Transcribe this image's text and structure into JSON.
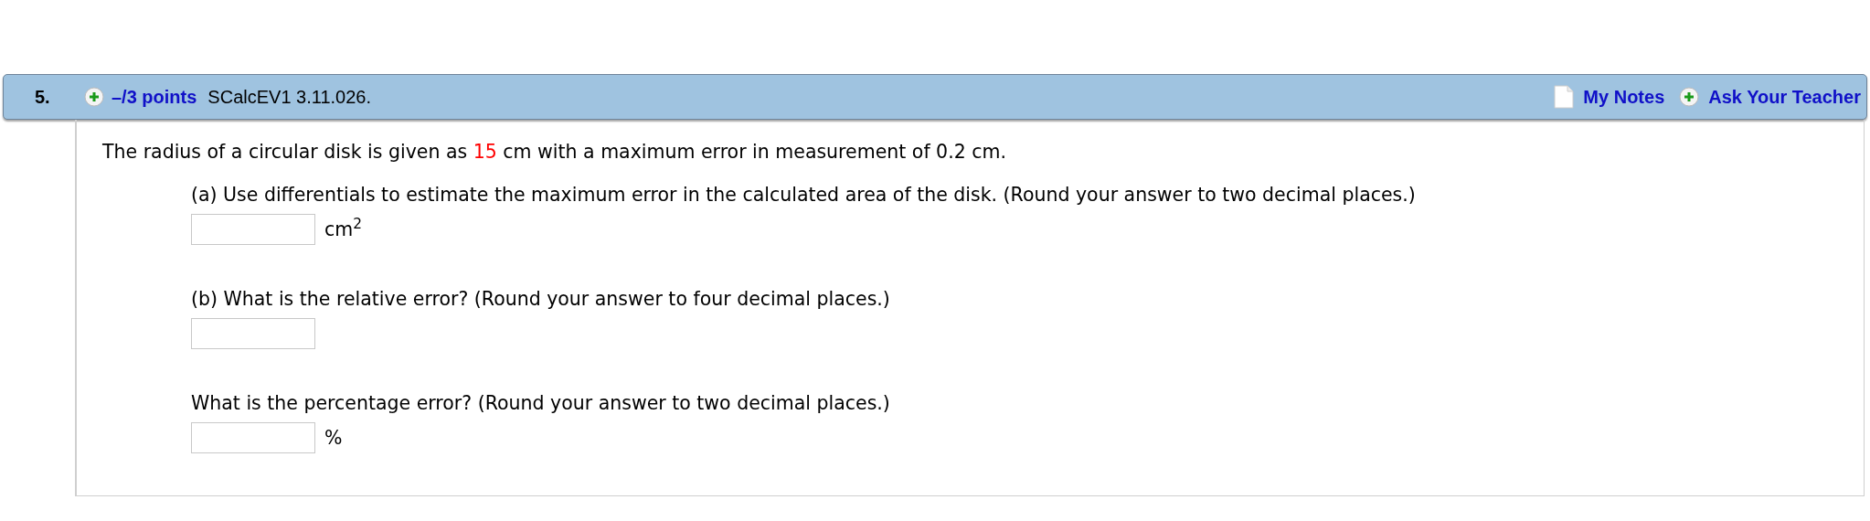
{
  "question": {
    "number": "5.",
    "points": "–/3 points",
    "source": "SCalcEV1 3.11.026.",
    "links": [
      {
        "kind": "notes",
        "label": "My Notes"
      },
      {
        "kind": "ask",
        "label": "Ask Your Teacher"
      }
    ]
  },
  "intro": {
    "before": "The radius of a circular disk is given as ",
    "value": "15",
    "after": " cm with a maximum error in measurement of 0.2 cm."
  },
  "parts": [
    {
      "prompt": "(a) Use differentials to estimate the maximum error in the calculated area of the disk. (Round your answer to two decimal places.)",
      "unit": "cm$^{2}$"
    },
    {
      "prompt": "(b) What is the relative error? (Round your answer to four decimal places.)"
    },
    {
      "prompt": "What is the percentage error? (Round your answer to two decimal places.)",
      "unit": "%"
    }
  ]
}
